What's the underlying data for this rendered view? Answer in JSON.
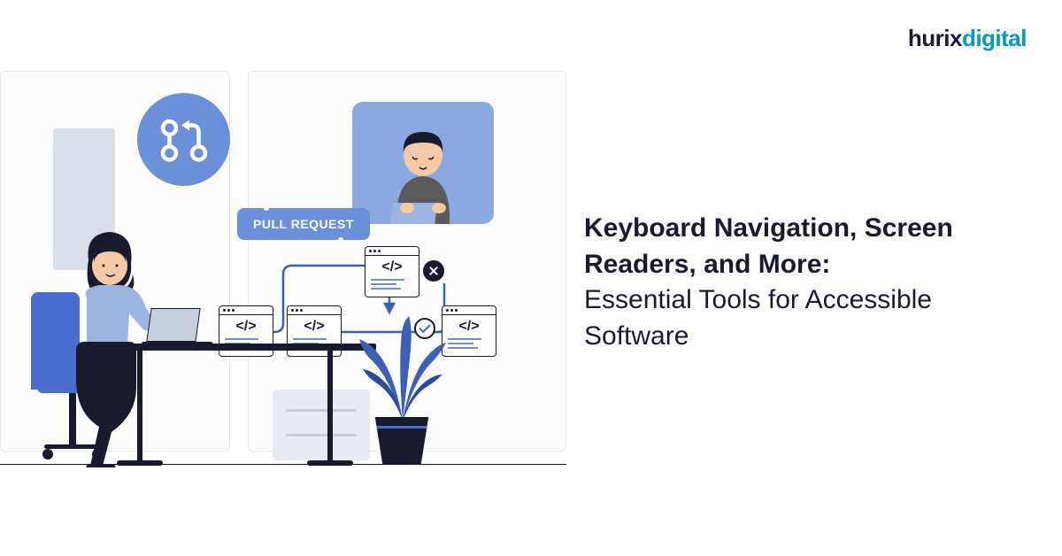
{
  "logo": {
    "part1": "hurix",
    "part2": "digital"
  },
  "title": {
    "bold": "Keyboard Navigation, Screen Readers, and More:",
    "regular": "Essential Tools for Accessible Software"
  },
  "illustration": {
    "badge": "PULL REQUEST",
    "code_tag": "</>"
  }
}
